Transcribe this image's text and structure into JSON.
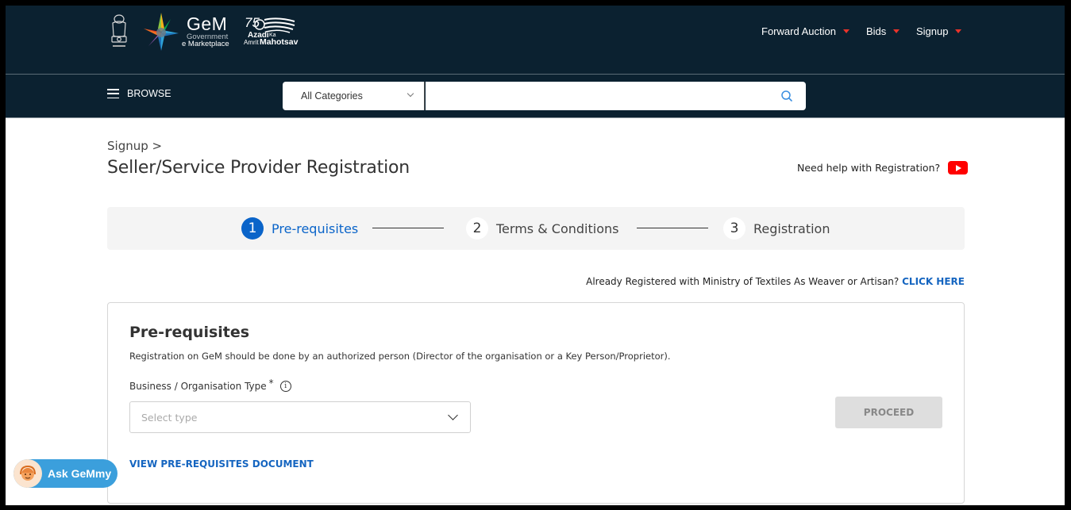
{
  "header": {
    "brand": {
      "name": "GeM",
      "line1": "Government",
      "line2": "e Marketplace"
    },
    "azadi": {
      "number": "75",
      "line1": "Azadi",
      "ka": "Ka",
      "line2a": "Amrit",
      "line2b": "Mahotsav"
    },
    "nav": [
      {
        "label": "Forward Auction"
      },
      {
        "label": "Bids"
      },
      {
        "label": "Signup"
      }
    ],
    "accent_color": "#e8332a",
    "background_color": "#0b2130"
  },
  "navbar": {
    "browse_label": "BROWSE",
    "category_select": "All Categories",
    "search_value": "",
    "search_placeholder": ""
  },
  "page": {
    "breadcrumb": "Signup >",
    "title": "Seller/Service Provider Registration",
    "help_text": "Need help with Registration?"
  },
  "stepper": {
    "steps": [
      {
        "number": "1",
        "label": "Pre-requisites",
        "active": true
      },
      {
        "number": "2",
        "label": "Terms & Conditions",
        "active": false
      },
      {
        "number": "3",
        "label": "Registration",
        "active": false
      }
    ],
    "active_color": "#0a64c9"
  },
  "textiles": {
    "text": "Already Registered with Ministry of Textiles As Weaver or Artisan?",
    "link": "CLICK HERE"
  },
  "card": {
    "title": "Pre-requisites",
    "description": "Registration on GeM should be done by an authorized person (Director of the organisation or a Key Person/Proprietor).",
    "field_label": "Business / Organisation Type",
    "required_mark": "*",
    "info_glyph": "i",
    "select_placeholder": "Select type",
    "proceed_label": "PROCEED",
    "doc_link": "VIEW PRE-REQUISITES DOCUMENT"
  },
  "chatbot": {
    "label": "Ask GeMmy"
  }
}
